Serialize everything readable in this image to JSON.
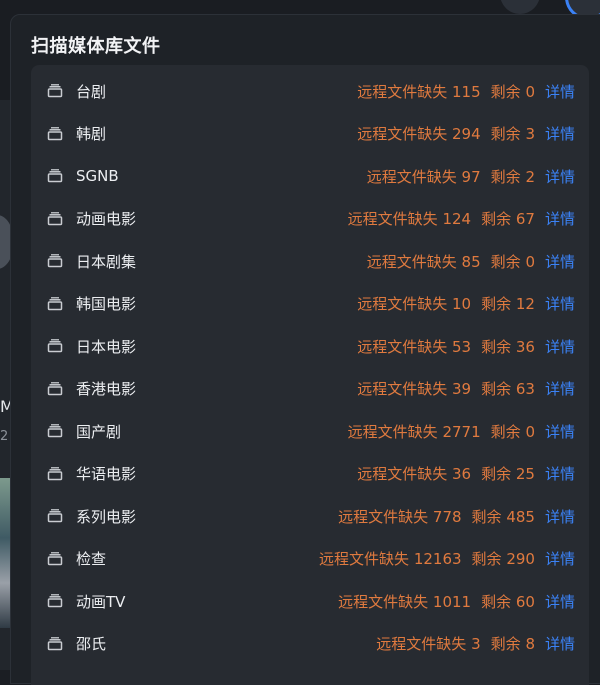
{
  "dialog": {
    "title": "扫描媒体库文件"
  },
  "background": {
    "partial_text_1": "M",
    "partial_text_2": "2"
  },
  "labels": {
    "missing_prefix": "远程文件缺失",
    "remain_prefix": "剩余",
    "detail": "详情"
  },
  "libraries": [
    {
      "name": "台剧",
      "missing": "115",
      "remain": "0"
    },
    {
      "name": "韩剧",
      "missing": "294",
      "remain": "3"
    },
    {
      "name": "SGNB",
      "missing": "97",
      "remain": "2"
    },
    {
      "name": "动画电影",
      "missing": "124",
      "remain": "67"
    },
    {
      "name": "日本剧集",
      "missing": "85",
      "remain": "0"
    },
    {
      "name": "韩国电影",
      "missing": "10",
      "remain": "12"
    },
    {
      "name": "日本电影",
      "missing": "53",
      "remain": "36"
    },
    {
      "name": "香港电影",
      "missing": "39",
      "remain": "63"
    },
    {
      "name": "国产剧",
      "missing": "2771",
      "remain": "0"
    },
    {
      "name": "华语电影",
      "missing": "36",
      "remain": "25"
    },
    {
      "name": "系列电影",
      "missing": "778",
      "remain": "485"
    },
    {
      "name": "检查",
      "missing": "12163",
      "remain": "290"
    },
    {
      "name": "动画TV",
      "missing": "1011",
      "remain": "60"
    },
    {
      "name": "邵氏",
      "missing": "3",
      "remain": "8"
    }
  ],
  "colors": {
    "missing": "#e07a3f",
    "link": "#3b82f6",
    "panel": "#272b31"
  }
}
